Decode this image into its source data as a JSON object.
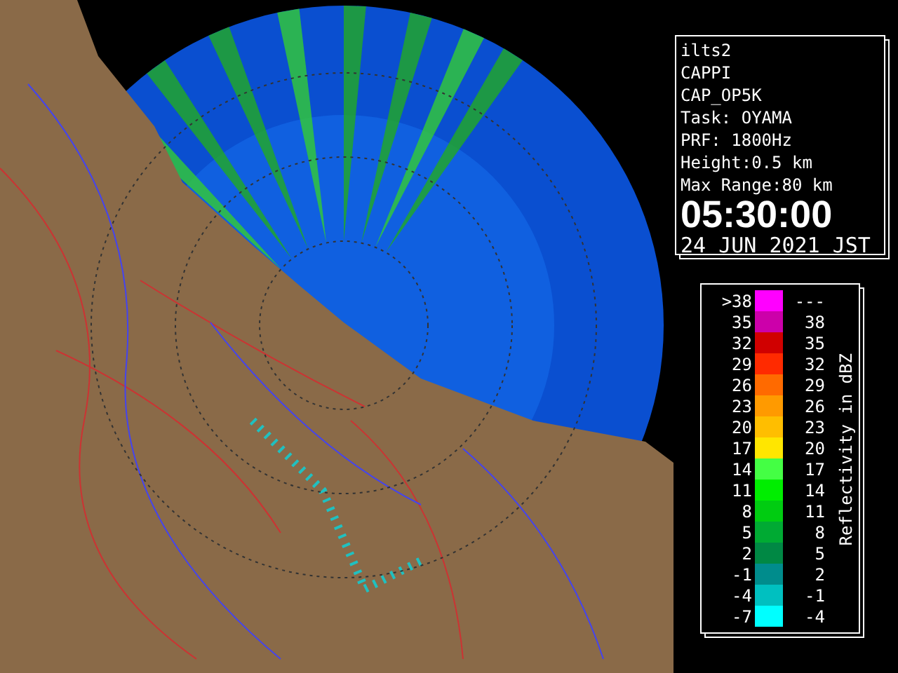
{
  "info": {
    "lines": [
      "ilts2",
      "CAPPI",
      "CAP_OP5K",
      "Task: OYAMA",
      "PRF: 1800Hz",
      "Height:0.5 km",
      "Max Range:80 km"
    ],
    "time": "05:30:00",
    "date": "24 JUN 2021 JST"
  },
  "legend": {
    "title": "Reflectivity in dBZ",
    "rows": [
      {
        "low": ">38",
        "high": "---",
        "color": "#ff00ff"
      },
      {
        "low": "35",
        "high": "38",
        "color": "#cc00aa"
      },
      {
        "low": "32",
        "high": "35",
        "color": "#d00000"
      },
      {
        "low": "29",
        "high": "32",
        "color": "#ff2a00"
      },
      {
        "low": "26",
        "high": "29",
        "color": "#ff6a00"
      },
      {
        "low": "23",
        "high": "26",
        "color": "#ff9a00"
      },
      {
        "low": "20",
        "high": "23",
        "color": "#ffbe00"
      },
      {
        "low": "17",
        "high": "20",
        "color": "#ffe600"
      },
      {
        "low": "14",
        "high": "17",
        "color": "#44ff44"
      },
      {
        "low": "11",
        "high": "14",
        "color": "#00ee00"
      },
      {
        "low": "8",
        "high": "11",
        "color": "#00cc11"
      },
      {
        "low": "5",
        "high": "8",
        "color": "#00aa33"
      },
      {
        "low": "2",
        "high": "5",
        "color": "#008844"
      },
      {
        "low": "-1",
        "high": "2",
        "color": "#008c8c"
      },
      {
        "low": "-4",
        "high": "-1",
        "color": "#00c0c0"
      },
      {
        "low": "-7",
        "high": "-4",
        "color": "#00ffff"
      }
    ]
  }
}
